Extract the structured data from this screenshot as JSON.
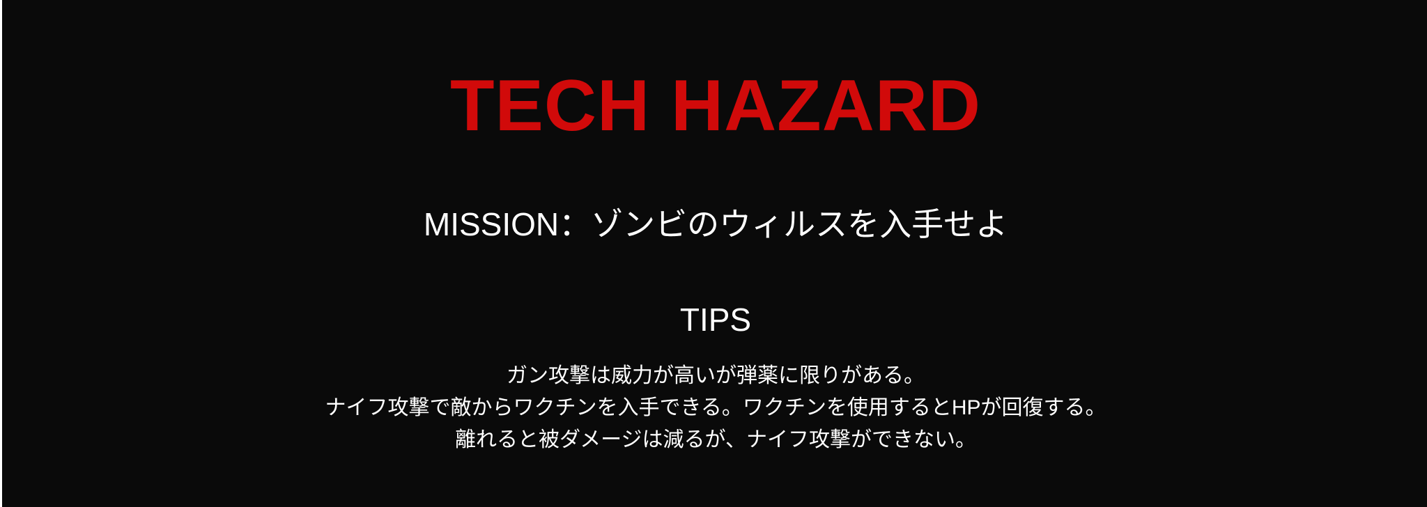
{
  "title": "TECH HAZARD",
  "mission": "MISSION：ゾンビのウィルスを入手せよ",
  "tips": {
    "heading": "TIPS",
    "lines": [
      "ガン攻撃は威力が高いが弾薬に限りがある。",
      "ナイフ攻撃で敵からワクチンを入手できる。ワクチンを使用するとHPが回復する。",
      "離れると被ダメージは減るが、ナイフ攻撃ができない。"
    ]
  },
  "colors": {
    "background": "#0a0a0a",
    "title": "#d10a0a",
    "text": "#ffffff"
  }
}
